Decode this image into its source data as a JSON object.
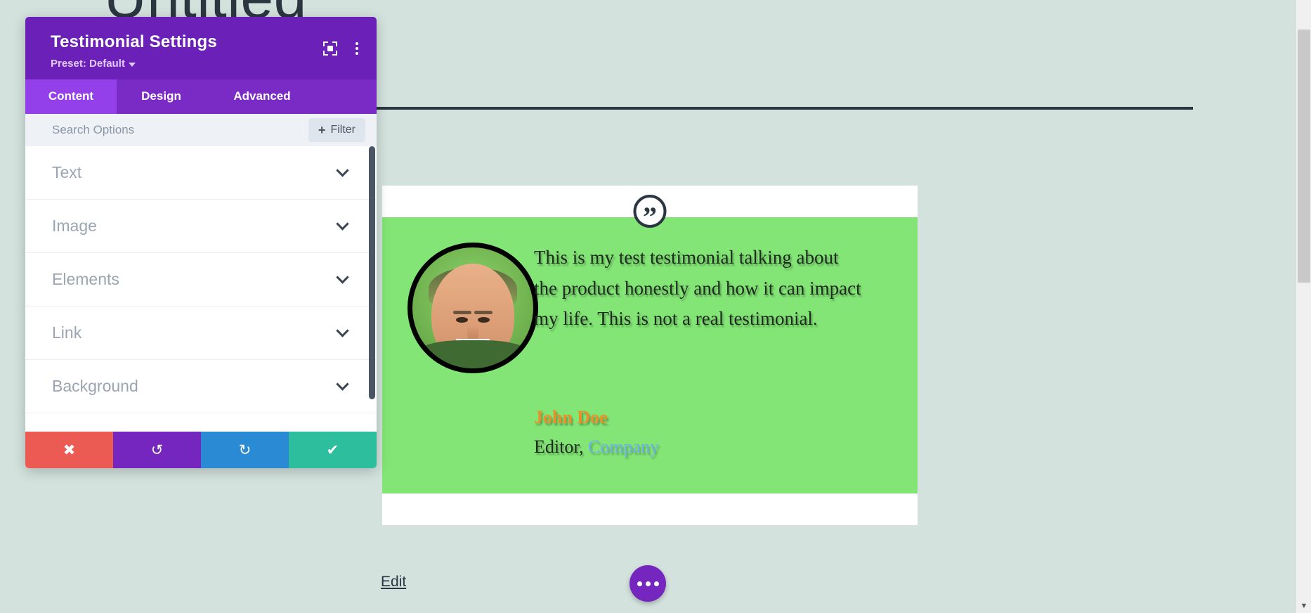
{
  "page": {
    "heading": "Untitled",
    "background_color": "#d3e2dd",
    "divider_color": "#2b3641",
    "edit_link": "Edit",
    "more_button_label": "•••"
  },
  "testimonial": {
    "quote_icon": "quotation-mark-icon",
    "quote_text": "This is my test testimonial talking about the product honestly and how it can impact my life. This is not a real testimonial.",
    "author_name": "John Doe",
    "author_position": "Editor,",
    "author_company": "Company",
    "card_background": "#ffffff",
    "body_background": "#83e575",
    "name_color": "#e8912a",
    "company_color": "#6bb2e8",
    "position_color": "#1e2a20",
    "portrait_alt": "portrait-photo"
  },
  "modal": {
    "title": "Testimonial Settings",
    "preset_label": "Preset: Default",
    "header_color": "#6b21b8",
    "focus_icon": "focus-frame-icon",
    "kebab_icon": "more-options-icon",
    "tabs": [
      {
        "label": "Content",
        "active": true
      },
      {
        "label": "Design",
        "active": false
      },
      {
        "label": "Advanced",
        "active": false
      }
    ],
    "search": {
      "placeholder": "Search Options",
      "value": ""
    },
    "filter": {
      "label": "Filter",
      "plus": "+"
    },
    "sections": [
      {
        "label": "Text"
      },
      {
        "label": "Image"
      },
      {
        "label": "Elements"
      },
      {
        "label": "Link"
      },
      {
        "label": "Background"
      }
    ],
    "actions": [
      {
        "name": "cancel",
        "glyph": "✖",
        "color": "#ec5b53"
      },
      {
        "name": "undo",
        "glyph": "↺",
        "color": "#7526bf"
      },
      {
        "name": "redo",
        "glyph": "↻",
        "color": "#2a8ad4"
      },
      {
        "name": "save",
        "glyph": "✔",
        "color": "#2dbe9d"
      }
    ]
  }
}
